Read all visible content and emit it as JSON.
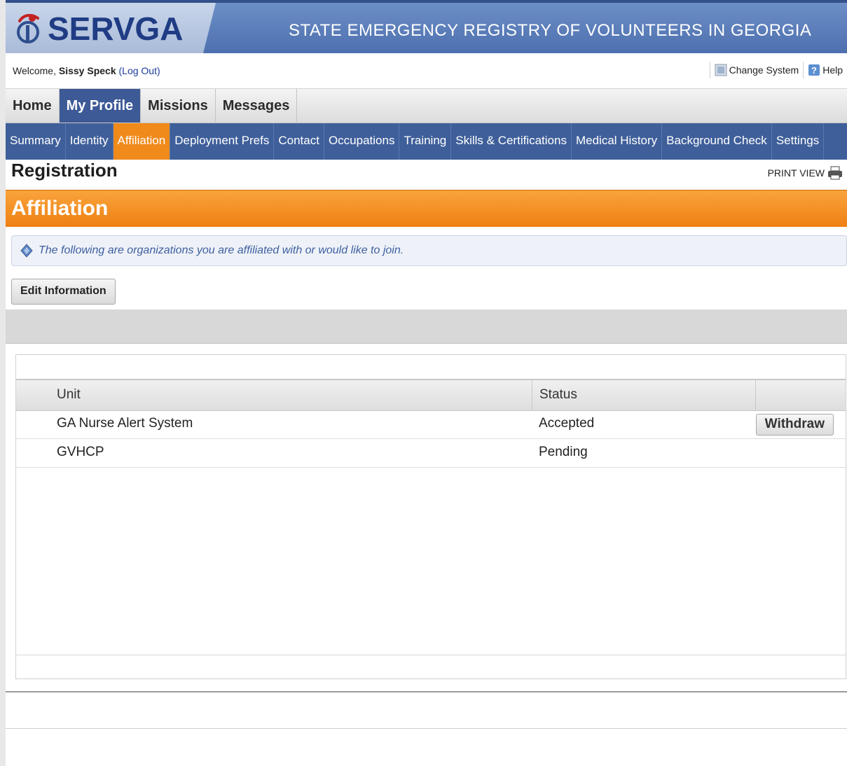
{
  "app": {
    "logo": "SERVGA",
    "tagline": "STATE EMERGENCY REGISTRY OF VOLUNTEERS IN GEORGIA"
  },
  "welcome": {
    "prefix": "Welcome,",
    "user": "Sissy Speck",
    "logout": "(Log Out)",
    "change_system": "Change System",
    "help": "Help"
  },
  "main_nav": [
    "Home",
    "My Profile",
    "Missions",
    "Messages"
  ],
  "sub_nav": [
    "Summary",
    "Identity",
    "Affiliation",
    "Deployment Prefs",
    "Contact",
    "Occupations",
    "Training",
    "Skills & Certifications",
    "Medical History",
    "Background Check",
    "Settings"
  ],
  "page": {
    "title": "Registration",
    "print_view": "PRINT VIEW",
    "section_title": "Affiliation",
    "info": "The following are organizations you are affiliated with or would like to join.",
    "edit_button": "Edit Information"
  },
  "table": {
    "headers": {
      "unit": "Unit",
      "status": "Status"
    },
    "rows": [
      {
        "unit": "GA Nurse Alert System",
        "status": "Accepted",
        "action": "Withdraw"
      },
      {
        "unit": "GVHCP",
        "status": "Pending"
      }
    ]
  },
  "colors": {
    "nav_blue": "#3f5f9a",
    "accent_orange": "#ef7f12",
    "link_blue": "#1a3c9c"
  }
}
